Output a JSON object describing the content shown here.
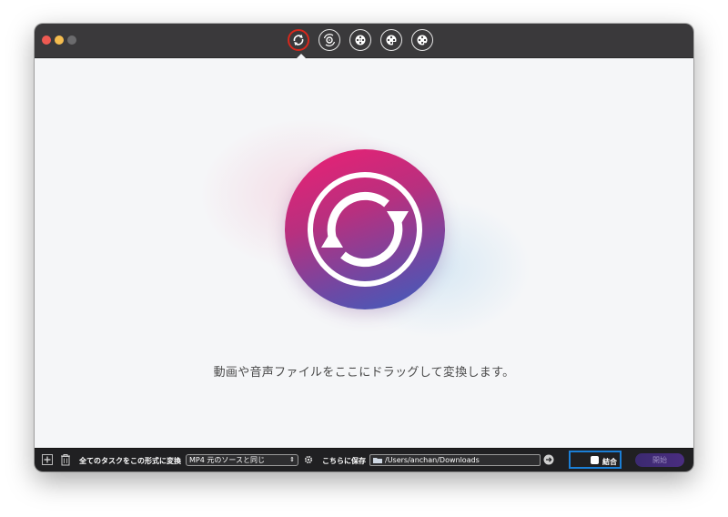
{
  "toolbar": {
    "tools": [
      {
        "name": "convert-tool",
        "active": true
      },
      {
        "name": "burn-tool",
        "active": false
      },
      {
        "name": "dvd-tool-1",
        "active": false
      },
      {
        "name": "dvd-tool-2",
        "active": false
      },
      {
        "name": "dvd-tool-3",
        "active": false
      }
    ]
  },
  "main": {
    "drop_text": "動画や音声ファイルをここにドラッグして変換します。",
    "icon": "convert-arrows-icon"
  },
  "bottombar": {
    "format_label": "全てのタスクをこの形式に変換",
    "format_value": "MP4 元のソースと同じ",
    "save_label": "こちらに保存",
    "save_path": "/Users/anchan/Downloads",
    "merge_label": "結合",
    "start_label": "開始"
  },
  "colors": {
    "titlebar": "#3a393b",
    "bottombar": "#202022",
    "active_ring": "#d8281c",
    "merge_highlight": "#1b7fd6",
    "accent_pink": "#ee1f73",
    "accent_blue": "#3b5fbf"
  }
}
